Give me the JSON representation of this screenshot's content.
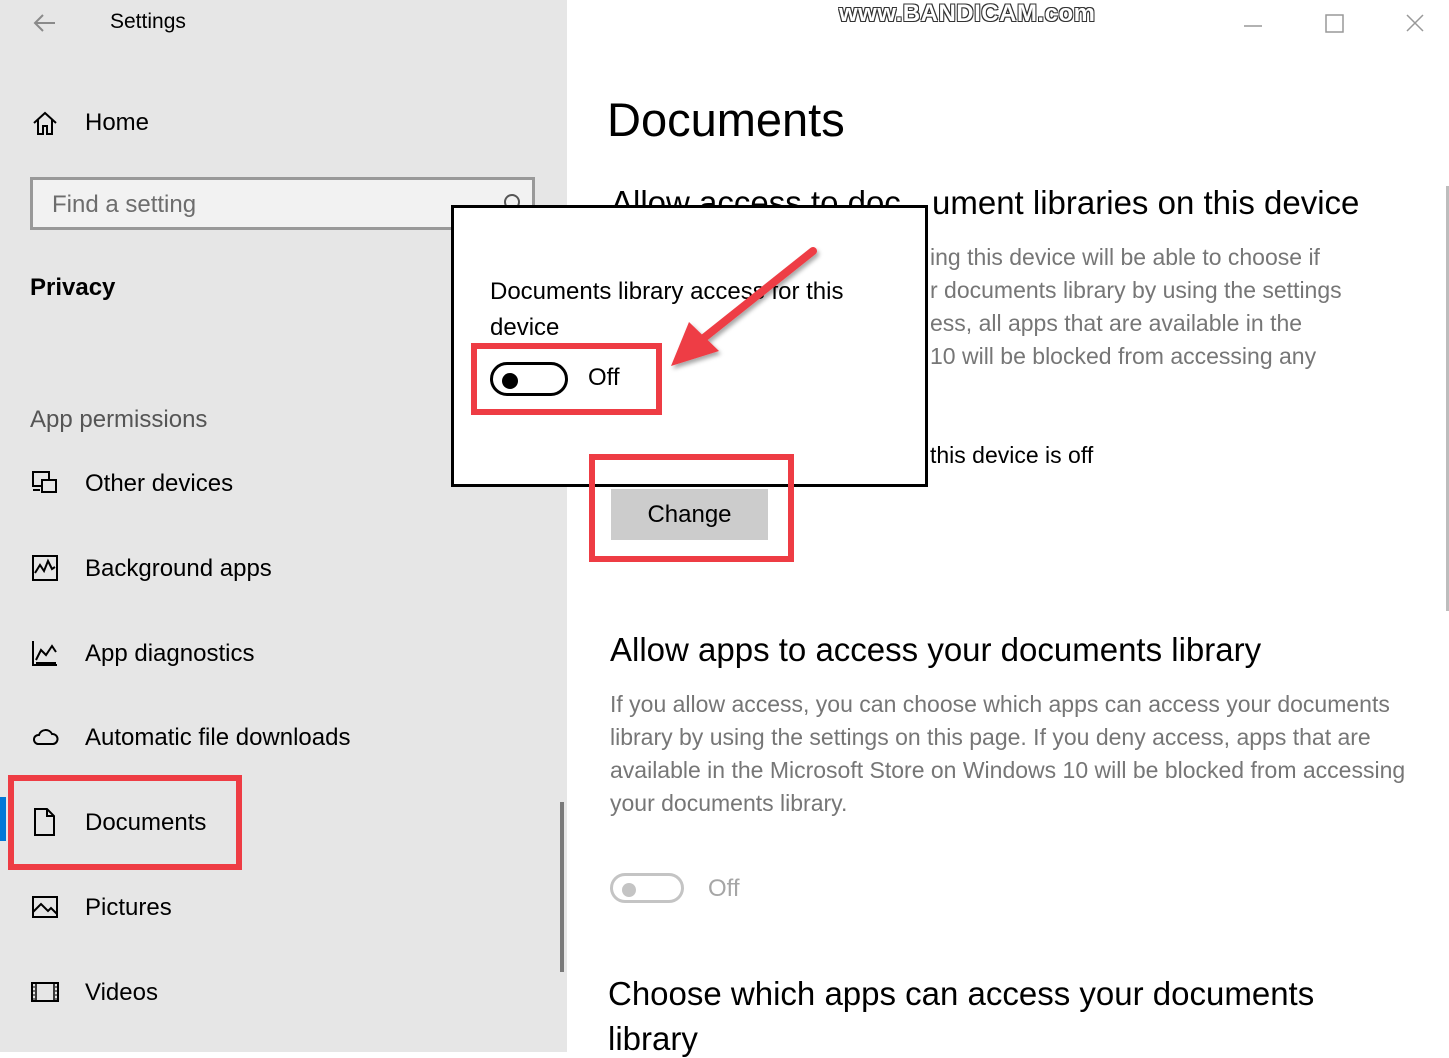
{
  "window": {
    "title": "Settings",
    "watermark": "www.BANDICAM.com"
  },
  "sidebar": {
    "home_label": "Home",
    "search_placeholder": "Find a setting",
    "section_title": "Privacy",
    "section_subtitle": "App permissions",
    "items": [
      {
        "label": "Other devices",
        "icon": "other-devices-icon"
      },
      {
        "label": "Background apps",
        "icon": "background-apps-icon"
      },
      {
        "label": "App diagnostics",
        "icon": "app-diagnostics-icon"
      },
      {
        "label": "Automatic file downloads",
        "icon": "cloud-icon"
      },
      {
        "label": "Documents",
        "icon": "document-icon",
        "selected": true
      },
      {
        "label": "Pictures",
        "icon": "pictures-icon"
      },
      {
        "label": "Videos",
        "icon": "videos-icon"
      }
    ]
  },
  "main": {
    "page_title": "Documents",
    "section1": {
      "heading_left": "Allow access to doc",
      "heading_right": "ument libraries on this device",
      "desc_lines": [
        "ing this device will be able to choose if",
        "r documents library by using the settings",
        "ess, all apps that are available in the",
        "10 will be blocked from accessing any"
      ],
      "status_text": "this device is off",
      "change_button": "Change"
    },
    "section2": {
      "heading": "Allow apps to access your documents library",
      "desc": "If you allow access, you can choose which apps can access your documents library by using the settings on this page. If you deny access, apps that are available in the Microsoft Store on Windows 10 will be blocked from accessing your documents library.",
      "toggle_state": "Off",
      "toggle_on": false
    },
    "section3": {
      "heading_line1": "Choose which apps can access your documents",
      "heading_line2": "library"
    }
  },
  "popup": {
    "title": "Documents library access for this device",
    "toggle_state": "Off",
    "toggle_on": false
  },
  "colors": {
    "sidebar_bg": "#e6e6e6",
    "accent": "#0078d7",
    "annotation_red": "#ee3c44",
    "muted_text": "#767676"
  }
}
